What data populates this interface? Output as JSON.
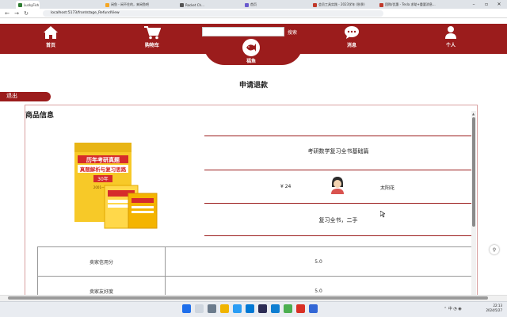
{
  "browser": {
    "tabs": [
      {
        "label": "LuckyFish",
        "active": true,
        "color": "#2e7d32"
      },
      {
        "label": "闲鱼 - 闲不住的，来闲鱼吧",
        "color": "#f5a623"
      },
      {
        "label": "Rocket Ch...",
        "color": "#555555"
      },
      {
        "label": "首页",
        "color": "#6a5acd"
      },
      {
        "label": "会员工具实践 - 2023学年 (秋季)",
        "color": "#c0392b"
      },
      {
        "label": "团购/优惠 - Tesla 求助+重要消息...",
        "color": "#c0392b"
      }
    ],
    "url": "localhost:5173/frontstage_RefundView"
  },
  "header": {
    "nav": [
      {
        "label": "首页",
        "icon": "home-icon"
      },
      {
        "label": "购物车",
        "icon": "cart-icon"
      },
      {
        "label": "消息",
        "icon": "chat-icon"
      },
      {
        "label": "个人",
        "icon": "user-icon"
      }
    ],
    "search_placeholder": "",
    "search_button": "搜索",
    "logo_text": "福鱼",
    "accent": "#9b1c1c"
  },
  "page": {
    "title": "申请退款",
    "logout": "退出",
    "section_title": "商品信息"
  },
  "product": {
    "title": "考研数学复习全书基础篇",
    "price": "¥ 24",
    "seller": "太阳花",
    "description": "复习全书，二手",
    "cover": {
      "headline": "历年考研真题",
      "subline": "真题解析与复习思路",
      "badge": "30年",
      "years": "2001—2024"
    }
  },
  "ratings": [
    {
      "label": "卖家信用分",
      "value": "5.0"
    },
    {
      "label": "卖家友好度",
      "value": "5.0"
    }
  ],
  "taskbar": {
    "time": "22:13",
    "date": "2024/5/27"
  }
}
